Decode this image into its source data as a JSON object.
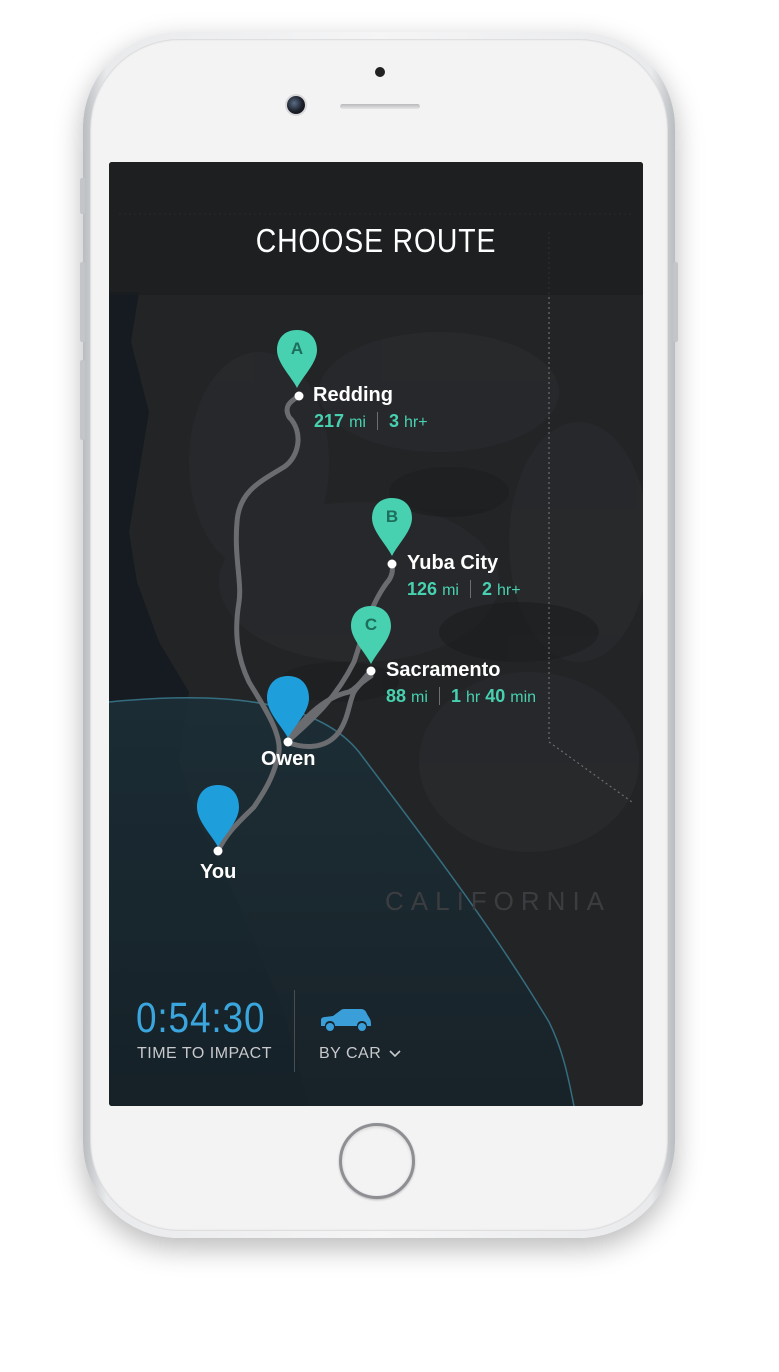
{
  "header": {
    "title": "CHOOSE ROUTE"
  },
  "map": {
    "state_label": "CALIFORNIA",
    "destinations": [
      {
        "letter": "A",
        "name": "Redding",
        "distance": "217",
        "distance_unit": "mi",
        "time_value": "3",
        "time_unit": "hr+",
        "time_value2": "",
        "time_unit2": ""
      },
      {
        "letter": "B",
        "name": "Yuba City",
        "distance": "126",
        "distance_unit": "mi",
        "time_value": "2",
        "time_unit": "hr+",
        "time_value2": "",
        "time_unit2": ""
      },
      {
        "letter": "C",
        "name": "Sacramento",
        "distance": "88",
        "distance_unit": "mi",
        "time_value": "1",
        "time_unit": "hr",
        "time_value2": "40",
        "time_unit2": "min"
      }
    ],
    "people": [
      {
        "name": "Owen"
      },
      {
        "name": "You"
      }
    ],
    "colors": {
      "destination_pin": "#47d1b0",
      "person_pin": "#1ea0dc",
      "route": "#6a6c70",
      "background": "#1c1d1f"
    }
  },
  "bottom": {
    "timer": "0:54:30",
    "timer_label": "TIME TO IMPACT",
    "mode_label": "BY CAR",
    "mode_icon": "car-icon",
    "dropdown_icon": "chevron-down-icon"
  }
}
